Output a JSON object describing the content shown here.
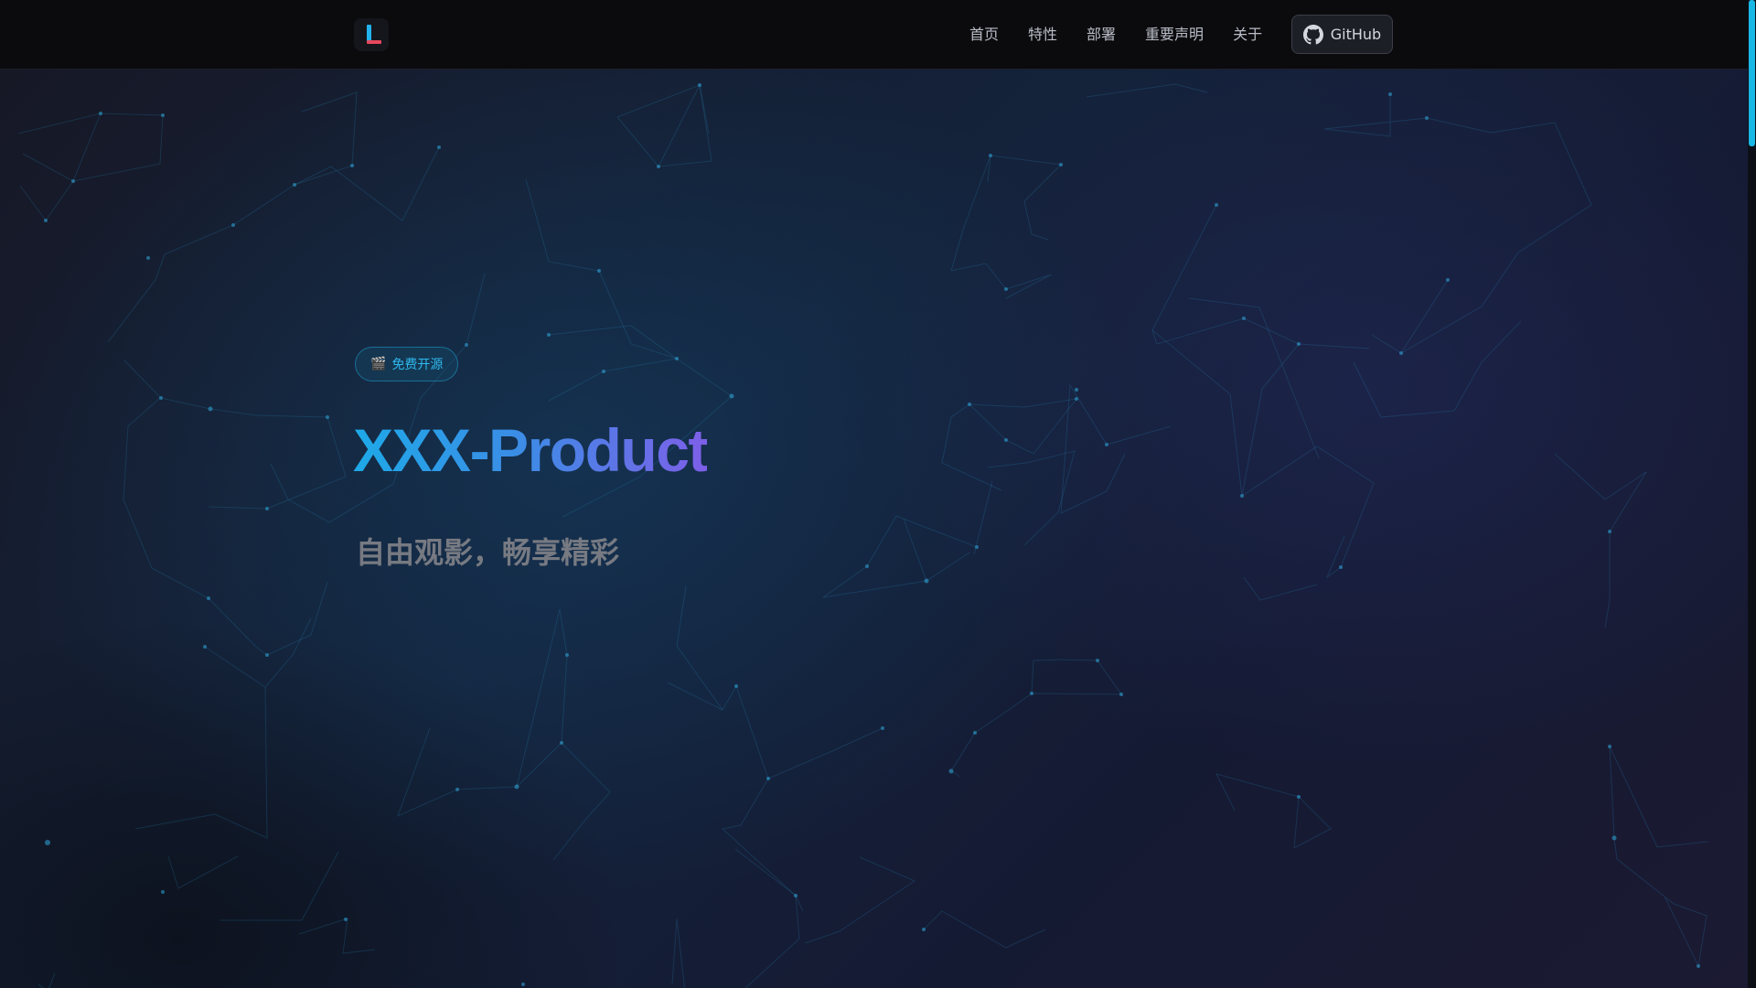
{
  "navbar": {
    "logo_icon": "logo-L-icon",
    "links": [
      "首页",
      "特性",
      "部署",
      "重要声明",
      "关于"
    ],
    "github_label": "GitHub",
    "github_icon": "github-icon"
  },
  "hero": {
    "badge_icon": "🎬",
    "badge_label": "免费开源",
    "title": "XXX-Product",
    "subtitle": "自由观影，畅享精彩"
  },
  "colors": {
    "accent": "#22b3ee",
    "title_gradient_start": "#1ea9e8",
    "title_gradient_end": "#7d5fe8",
    "logo_red": "#e5485d",
    "scrollbar": "#18b7e4"
  }
}
